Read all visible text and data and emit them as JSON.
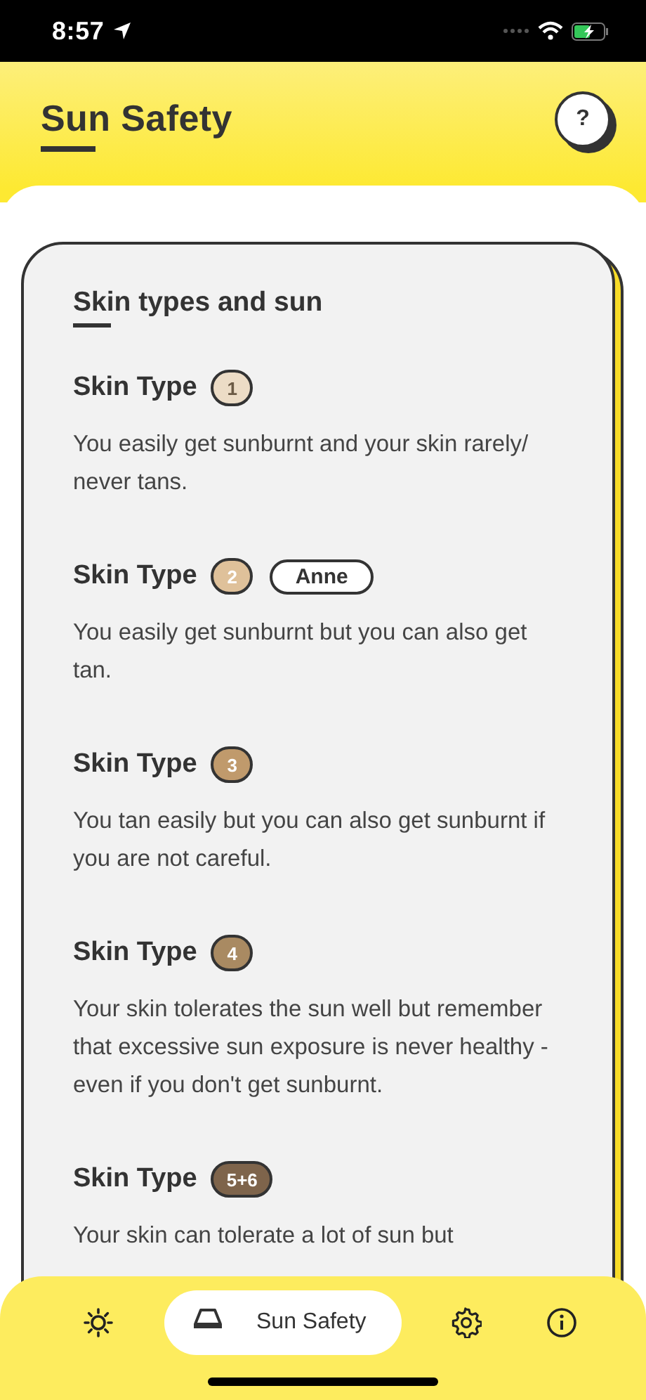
{
  "status_bar": {
    "time": "8:57"
  },
  "header": {
    "title": "Sun Safety",
    "help_button": "?"
  },
  "card": {
    "title": "Skin types and sun",
    "skin_types": [
      {
        "label": "Skin Type",
        "badge": "1",
        "color": "#ecdcc6",
        "description": "You easily get sunburnt and your skin rarely/ never tans."
      },
      {
        "label": "Skin Type",
        "badge": "2",
        "color": "#dfc19a",
        "tag": "Anne",
        "description": "You easily get sunburnt but you can also get tan."
      },
      {
        "label": "Skin Type",
        "badge": "3",
        "color": "#c09a6c",
        "description": "You tan easily but you can also get sunburnt if you are not careful."
      },
      {
        "label": "Skin Type",
        "badge": "4",
        "color": "#a98a62",
        "description": "Your skin tolerates the sun well but remember that excessive sun exposure is never healthy - even if you don't get sunburnt."
      },
      {
        "label": "Skin Type",
        "badge": "5+6",
        "color": "#7e644b",
        "description": "Your skin can tolerate a lot of sun but"
      }
    ]
  },
  "tab_bar": {
    "tabs": [
      {
        "kind": "sun",
        "selected": false
      },
      {
        "kind": "sunbed",
        "label": "Sun Safety",
        "selected": true
      },
      {
        "kind": "settings",
        "selected": false
      },
      {
        "kind": "info",
        "selected": false
      }
    ]
  }
}
